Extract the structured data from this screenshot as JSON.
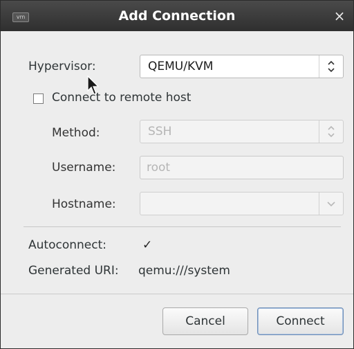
{
  "window": {
    "app_icon_text": "vm",
    "title": "Add Connection",
    "close_glyph": "×"
  },
  "hypervisor": {
    "label": "Hypervisor:",
    "value": "QEMU/KVM"
  },
  "remote": {
    "checkbox_label": "Connect to remote host",
    "checked": false
  },
  "method": {
    "label": "Method:",
    "value": "SSH"
  },
  "username": {
    "label": "Username:",
    "value": "root"
  },
  "hostname": {
    "label": "Hostname:",
    "value": ""
  },
  "autoconnect": {
    "label": "Autoconnect:",
    "checked": true,
    "check_glyph": "✓"
  },
  "uri": {
    "label": "Generated URI:",
    "value": "qemu:///system"
  },
  "buttons": {
    "cancel": "Cancel",
    "connect": "Connect"
  },
  "icons": {
    "combo_arrows": "updown-chevron-icon",
    "combo_down": "chevron-down-icon",
    "close": "close-icon",
    "cursor": "mouse-pointer-icon"
  }
}
